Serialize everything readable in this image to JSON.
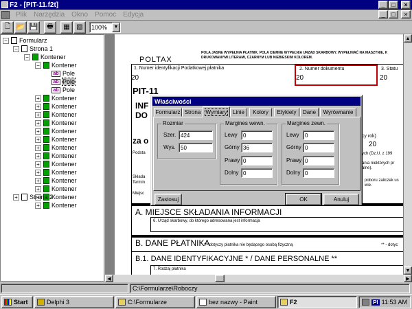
{
  "window": {
    "title": "F2 - [PIT-11.f2t]",
    "controls": {
      "minimize": "_",
      "maximize": "□",
      "close": "×"
    }
  },
  "menubar": {
    "items": [
      "Plik",
      "Narzędzia",
      "Okno",
      "Pomoc",
      "Edycja"
    ],
    "controls": {
      "minimize": "_",
      "restore": "□",
      "close": "×"
    }
  },
  "toolbar": {
    "zoom": "100%",
    "buttons": [
      "new-icon",
      "open-icon",
      "save-icon",
      "print-icon",
      "tool1-icon",
      "tool2-icon"
    ]
  },
  "tree": {
    "root": "Formularz",
    "page1": "Strona 1",
    "container": "Kontener",
    "field": "Pole",
    "page2": "Strona 2",
    "ab": "ab"
  },
  "document": {
    "poltax": "POLTAX",
    "instruction": "POLA JASNE WYPEŁNIA PŁATNIK. POLA CIEMNE WYPEŁNIA URZĄD SKARBOWY. WYPEŁNIAĆ NA MASZYNIE, K",
    "instruction2": "DRUKOWANYMI LITERAMI, CZARNYM LUB NIEBIESKIM KOLOREM.",
    "box1_label": "1. Numer identyfikacji Podatkowej płatnika",
    "box1_value": "20",
    "box2_label": "2. Numer dokumentu",
    "box2_value": "20",
    "box3_label": "3. Statu",
    "box3_value": "20",
    "form_title": "PIT-11",
    "inf": "INF",
    "do": "DO",
    "za": "za o",
    "year_label": "ący rok)",
    "year_value": "20",
    "dzu": "ych (Dz.U. z 199",
    "note1": "ania niektórych pr",
    "note1b": "alne).",
    "note2": "poboru zaliczek us",
    "note2b": "wie.",
    "podsta": "Podsta",
    "sklada": "Składa",
    "termin": "Termin",
    "miejsc": "Miejsc",
    "section_a": "A. MIEJSCE SKŁADANIA INFORMACJI",
    "field6": "6. Urząd skarbowy, do którego adresowana jest informacja",
    "section_b": "B. DANE PŁATNIKA",
    "section_b_note": "* - dotyczy płatnika nie będącego osobą fizyczną",
    "section_b_note2": "** - dotyc",
    "section_b1": "B.1. DANE IDENTYFIKACYJNE * / DANE PERSONALNE **",
    "field7": "7. Rodzaj płatnika"
  },
  "dialog": {
    "title": "Właściwości",
    "tabs": [
      "Formularz",
      "Strona",
      "Wymiary",
      "Linie",
      "Kolory",
      "Etykiety",
      "Dane",
      "Wyrównanie"
    ],
    "active_tab": "Wymiary",
    "size_group": "Rozmiar",
    "width_label": "Szer.",
    "width_value": "424",
    "height_label": "Wys.",
    "height_value": "50",
    "inner_group": "Margines wewn.",
    "outer_group": "Margines zewn.",
    "left_label": "Lewy",
    "top_label": "Górny",
    "right_label": "Prawy",
    "bottom_label": "Dolny",
    "inner": {
      "left": "0",
      "top": "36",
      "right": "0",
      "bottom": "0"
    },
    "outer": {
      "left": "0",
      "top": "0",
      "right": "0",
      "bottom": "0"
    },
    "apply": "Zastosuj",
    "ok": "OK",
    "cancel": "Anuluj"
  },
  "statusbar": {
    "path": "C:\\Formularze\\Roboczy"
  },
  "taskbar": {
    "start": "Start",
    "tasks": [
      "Delphi 3",
      "C:\\Formularze",
      "bez nazwy - Paint",
      "F2"
    ],
    "active": "F2",
    "lang": "Pl",
    "clock": "11:53 AM"
  }
}
